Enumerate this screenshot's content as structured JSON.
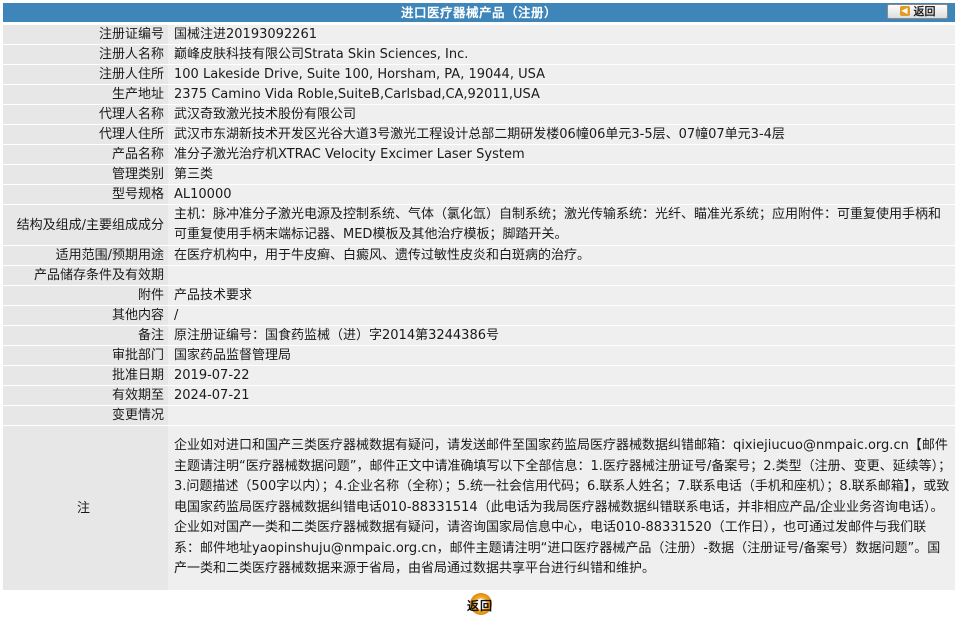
{
  "header": {
    "title": "进口医疗器械产品（注册）",
    "back_label": "返回"
  },
  "rows": [
    {
      "label": "注册证编号",
      "value": "国械注进20193092261"
    },
    {
      "label": "注册人名称",
      "value": "巅峰皮肤科技有限公司Strata Skin Sciences, Inc."
    },
    {
      "label": "注册人住所",
      "value": "100 Lakeside Drive, Suite 100, Horsham, PA, 19044, USA"
    },
    {
      "label": "生产地址",
      "value": "2375 Camino Vida Roble,SuiteB,Carlsbad,CA,92011,USA"
    },
    {
      "label": "代理人名称",
      "value": "武汉奇致激光技术股份有限公司"
    },
    {
      "label": "代理人住所",
      "value": "武汉市东湖新技术开发区光谷大道3号激光工程设计总部二期研发楼06幢06单元3-5层、07幢07单元3-4层"
    },
    {
      "label": "产品名称",
      "value": "准分子激光治疗机XTRAC Velocity Excimer Laser System"
    },
    {
      "label": "管理类别",
      "value": "第三类"
    },
    {
      "label": "型号规格",
      "value": "AL10000"
    },
    {
      "label": "结构及组成/主要组成成分",
      "value": "主机：脉冲准分子激光电源及控制系统、气体（氯化氙）自制系统；激光传输系统：光纤、瞄准光系统；应用附件：可重复使用手柄和可重复使用手柄末端标记器、MED模板及其他治疗模板；脚踏开关。"
    },
    {
      "label": "适用范围/预期用途",
      "value": "在医疗机构中，用于牛皮癣、白癜风、遗传过敏性皮炎和白斑病的治疗。"
    },
    {
      "label": "产品储存条件及有效期",
      "value": ""
    },
    {
      "label": "附件",
      "value": "产品技术要求"
    },
    {
      "label": "其他内容",
      "value": "/"
    },
    {
      "label": "备注",
      "value": "原注册证编号：国食药监械（进）字2014第3244386号"
    },
    {
      "label": "审批部门",
      "value": "国家药品监督管理局"
    },
    {
      "label": "批准日期",
      "value": "2019-07-22"
    },
    {
      "label": "有效期至",
      "value": "2024-07-21"
    },
    {
      "label": "变更情况",
      "value": ""
    }
  ],
  "note": {
    "label": "注",
    "text": "企业如对进口和国产三类医疗器械数据有疑问，请发送邮件至国家药监局医疗器械数据纠错邮箱：qixiejiucuo@nmpaic.org.cn【邮件主题请注明“医疗器械数据问题”，邮件正文中请准确填写以下全部信息：1.医疗器械注册证号/备案号；2.类型（注册、变更、延续等）；3.问题描述（500字以内）；4.企业名称（全称）；5.统一社会信用代码；6.联系人姓名；7.联系电话（手机和座机）；8.联系邮箱】，或致电国家药监局医疗器械数据纠错电话010-88331514（此电话为我局医疗器械数据纠错联系电话，并非相应产品/企业业务咨询电话）。企业如对国产一类和二类医疗器械数据有疑问，请咨询国家局信息中心，电话010-88331520（工作日），也可通过发邮件与我们联系：邮件地址yaopinshuju@nmpaic.org.cn，邮件主题请注明“进口医疗器械产品（注册）-数据（注册证号/备案号）数据问题”。国产一类和二类医疗器械数据来源于省局，由省局通过数据共享平台进行纠错和维护。"
  },
  "footer": {
    "back_label": "返回"
  },
  "colors": {
    "header_bg": "#3e86b9",
    "label_bg": "#e7e7e7",
    "value_bg": "#efefef",
    "back_button_accent": "#e0860d"
  },
  "icons": {
    "back_top": "arrow-left-icon",
    "back_footer": "circle-back-icon"
  }
}
